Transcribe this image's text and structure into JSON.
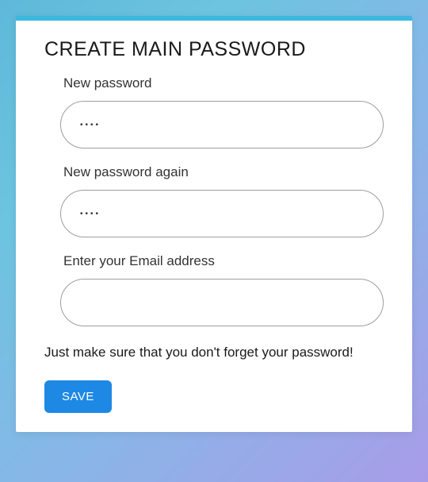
{
  "form": {
    "title": "CREATE MAIN PASSWORD",
    "fields": {
      "new_password": {
        "label": "New password",
        "value": "••••"
      },
      "new_password_again": {
        "label": "New password again",
        "value": "••••"
      },
      "email": {
        "label": "Enter your Email address",
        "value": ""
      }
    },
    "helper_text": "Just make sure that you don't forget your password!",
    "save_label": "SAVE"
  }
}
